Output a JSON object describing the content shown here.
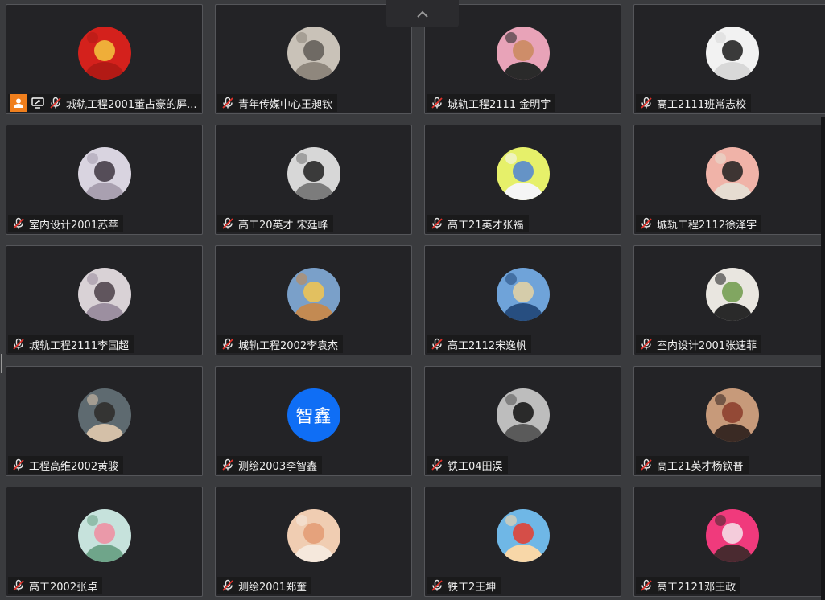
{
  "collapse_button": {
    "icon": "chevron-up-icon"
  },
  "colors": {
    "tile_bg": "#232326",
    "label_bg": "#1a1a1b",
    "host_badge": "#f07f1d",
    "mic_off_red": "#e0322b"
  },
  "participants": [
    {
      "name": "城轨工程2001董占豪的屏...",
      "mic": "muted",
      "is_host": true,
      "is_sharing": true,
      "avatar": {
        "kind": "image",
        "desc": "china-flag-avatar"
      }
    },
    {
      "name": "青年传媒中心王昶钦",
      "mic": "muted",
      "avatar": {
        "kind": "image",
        "desc": "wolves-avatar"
      }
    },
    {
      "name": "城轨工程2111 金明宇",
      "mic": "muted",
      "avatar": {
        "kind": "image",
        "desc": "dog-sunglasses-avatar"
      }
    },
    {
      "name": "高工2111班常志校",
      "mic": "muted",
      "avatar": {
        "kind": "image",
        "desc": "anime-sketch-avatar"
      }
    },
    {
      "name": "室内设计2001苏苹",
      "mic": "muted",
      "avatar": {
        "kind": "image",
        "desc": "woman-portrait-avatar"
      }
    },
    {
      "name": "高工20英才 宋廷峰",
      "mic": "muted",
      "avatar": {
        "kind": "image",
        "desc": "phone-selfie-avatar"
      }
    },
    {
      "name": "高工21英才张福",
      "mic": "muted",
      "avatar": {
        "kind": "image",
        "desc": "cartoon-boy-avatar"
      }
    },
    {
      "name": "城轨工程2112徐泽宇",
      "mic": "muted",
      "avatar": {
        "kind": "image",
        "desc": "man-portrait-avatar"
      }
    },
    {
      "name": "城轨工程2111李国超",
      "mic": "muted",
      "avatar": {
        "kind": "image",
        "desc": "anime-boy-avatar"
      }
    },
    {
      "name": "城轨工程2002李袁杰",
      "mic": "muted",
      "avatar": {
        "kind": "image",
        "desc": "cartoon-animal-avatar"
      }
    },
    {
      "name": "高工2112宋逸帆",
      "mic": "muted",
      "avatar": {
        "kind": "image",
        "desc": "sea-illustration-avatar"
      }
    },
    {
      "name": "室内设计2001张速菲",
      "mic": "muted",
      "avatar": {
        "kind": "image",
        "desc": "girl-book-avatar"
      }
    },
    {
      "name": "工程高维2002黄骏",
      "mic": "muted",
      "avatar": {
        "kind": "image",
        "desc": "couple-photo-avatar"
      }
    },
    {
      "name": "测绘2003李智鑫",
      "mic": "muted",
      "avatar": {
        "kind": "text",
        "text": "智鑫",
        "color": "#0f6ef5"
      }
    },
    {
      "name": "铁工04田淏",
      "mic": "muted",
      "avatar": {
        "kind": "image",
        "desc": "black-dog-avatar"
      }
    },
    {
      "name": "高工21英才杨钦普",
      "mic": "muted",
      "avatar": {
        "kind": "image",
        "desc": "movie-boy-avatar"
      }
    },
    {
      "name": "高工2002张卓",
      "mic": "muted",
      "avatar": {
        "kind": "image",
        "desc": "lotus-avatar"
      }
    },
    {
      "name": "测绘2001郑奎",
      "mic": "muted",
      "avatar": {
        "kind": "image",
        "desc": "cat-avatar"
      }
    },
    {
      "name": "铁工2王坤",
      "mic": "muted",
      "avatar": {
        "kind": "image",
        "desc": "crayon-shin-avatar"
      }
    },
    {
      "name": "高工2121邓王政",
      "mic": "muted",
      "avatar": {
        "kind": "image",
        "desc": "anime-pink-avatar"
      }
    }
  ]
}
